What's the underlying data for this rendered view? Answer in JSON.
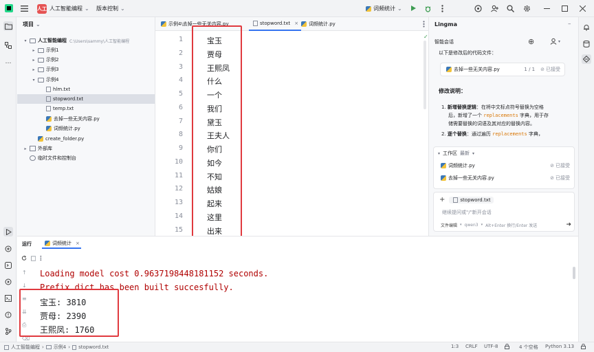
{
  "titlebar": {
    "project_badge": "人工",
    "project_name": "人工智能编程",
    "vcs": "版本控制",
    "run_config": "词频统计"
  },
  "project_panel": {
    "title": "项目",
    "root_name": "人工智能编程",
    "root_path": "C:\\Users\\sammy\\人工智能编程",
    "items": [
      {
        "label": "示例1"
      },
      {
        "label": "示例2"
      },
      {
        "label": "示例3"
      },
      {
        "label": "示例4"
      },
      {
        "label": "hlm.txt"
      },
      {
        "label": "stopword.txt"
      },
      {
        "label": "temp.txt"
      },
      {
        "label": "去掉一些无关内容.py"
      },
      {
        "label": "词频统计.py"
      },
      {
        "label": "create_folder.py"
      },
      {
        "label": "外部库"
      },
      {
        "label": "临时文件和控制台"
      }
    ]
  },
  "editor": {
    "tabs": [
      {
        "label": "示例4\\去掉一些无关内容.py"
      },
      {
        "label": "stopword.txt"
      },
      {
        "label": "词频统计.py"
      }
    ],
    "lines": [
      {
        "n": "1",
        "text": "宝玉"
      },
      {
        "n": "2",
        "text": "贾母"
      },
      {
        "n": "3",
        "text": "王熙凤"
      },
      {
        "n": "4",
        "text": "什么"
      },
      {
        "n": "5",
        "text": "一个"
      },
      {
        "n": "6",
        "text": "我们"
      },
      {
        "n": "7",
        "text": "黛玉"
      },
      {
        "n": "8",
        "text": "王夫人"
      },
      {
        "n": "9",
        "text": "你们"
      },
      {
        "n": "10",
        "text": "如今"
      },
      {
        "n": "11",
        "text": "不知"
      },
      {
        "n": "12",
        "text": "姑娘"
      },
      {
        "n": "13",
        "text": "起来"
      },
      {
        "n": "14",
        "text": "这里"
      },
      {
        "n": "15",
        "text": "出来"
      }
    ]
  },
  "ai_panel": {
    "title": "Lingma",
    "session": "智能会话",
    "intro": "以下是修改后的代码文件：",
    "file_card": {
      "name": "去掉一些无关内容.py",
      "count": "1 / 1",
      "status": "已接受"
    },
    "explain_title": "修改说明：",
    "point1_lead": "新增替换逻辑",
    "point1_a": "：在将中文标点符号替换为空格",
    "point1_b": "后，新增了一个 ",
    "point1_code": "replacements",
    "point1_c": " 字典，用于存",
    "point1_d": "储需要替换的词语及其对应的替换内容。",
    "point2_lead": "逐个替换",
    "point2_a": "：通过遍历 ",
    "point2_code": "replacements",
    "point2_b": " 字典，",
    "workspace_label": "工作区",
    "workspace_sort": "最新",
    "workspace_files": [
      {
        "name": "词频统计.py",
        "status": "已接受"
      },
      {
        "name": "去掉一些无关内容.py",
        "status": "已接受"
      }
    ],
    "context_file": "stopword.txt",
    "input_placeholder": "继续提问或\"/\"新开会话",
    "mode": "文件编辑",
    "model": "qwen3",
    "hint": "Alt+Enter 换行/Enter 发送"
  },
  "run_panel": {
    "tab_label": "运行",
    "config": "词频统计",
    "lines": [
      {
        "text": "Loading model cost 0.9637198448181152 seconds.",
        "kind": "err"
      },
      {
        "text": "Prefix dict has been built succesfully.",
        "kind": "err"
      },
      {
        "text": "宝玉: 3810",
        "kind": "out"
      },
      {
        "text": "贾母: 2390",
        "kind": "out"
      },
      {
        "text": "王熙凤: 1760",
        "kind": "out"
      }
    ]
  },
  "statusbar": {
    "crumb1": "人工智能编程",
    "crumb2": "示例4",
    "crumb3": "stopword.txt",
    "position": "1:3",
    "line_sep": "CRLF",
    "encoding": "UTF-8",
    "indent": "4 个空格",
    "interpreter": "Python 3.13"
  },
  "colors": {
    "accent": "#3574f0",
    "highlight_box": "#e0393e",
    "error_text": "#b00000",
    "project_badge": "#e55353"
  }
}
